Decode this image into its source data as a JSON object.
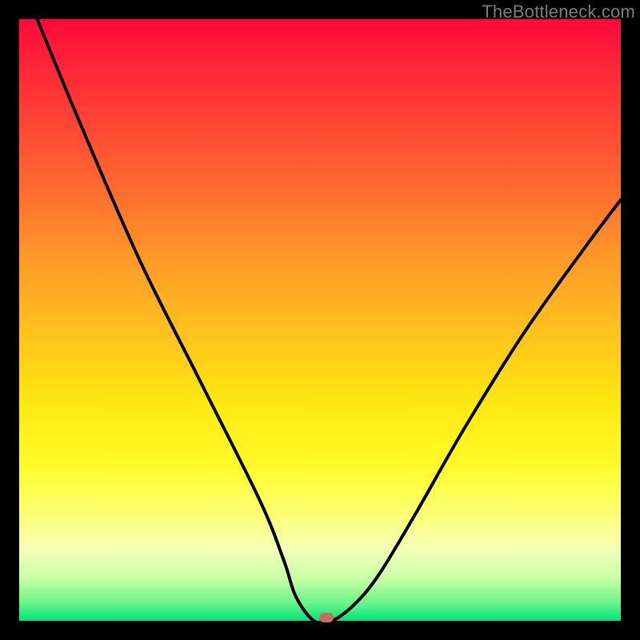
{
  "watermark": "TheBottleneck.com",
  "chart_data": {
    "type": "line",
    "title": "",
    "xlabel": "",
    "ylabel": "",
    "xlim": [
      0,
      100
    ],
    "ylim": [
      0,
      100
    ],
    "grid": false,
    "series": [
      {
        "name": "curve",
        "x": [
          3,
          10,
          20,
          30,
          40,
          44,
          46,
          49,
          52,
          56,
          60,
          66,
          74,
          84,
          94,
          100
        ],
        "values": [
          100,
          83,
          60,
          40,
          20,
          10,
          4,
          0,
          0,
          3,
          8,
          18,
          32,
          48,
          62,
          70
        ]
      }
    ],
    "annotations": [
      {
        "name": "marker",
        "x": 51,
        "y": 0.5
      }
    ],
    "colors": {
      "gradient_top": "#ff0a3a",
      "gradient_bottom": "#00e37a",
      "curve": "#000000",
      "marker": "#c96b62",
      "frame": "#000000"
    }
  }
}
